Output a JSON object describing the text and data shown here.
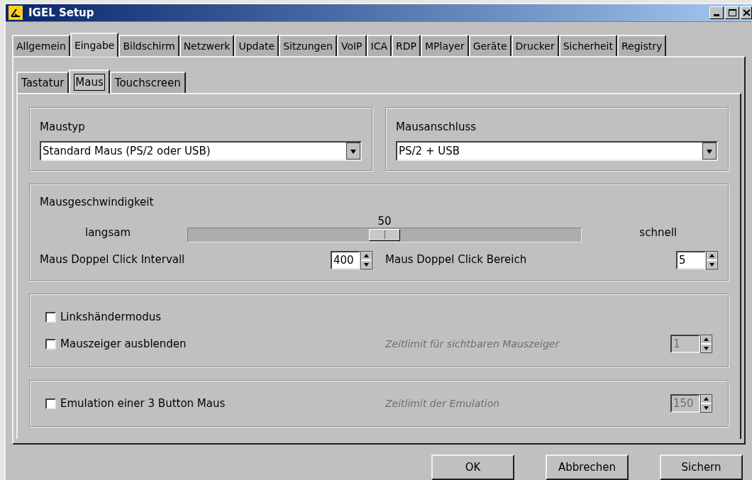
{
  "window": {
    "title": "IGEL Setup"
  },
  "tabs": [
    {
      "label": "Allgemein",
      "selected": false
    },
    {
      "label": "Eingabe",
      "selected": true
    },
    {
      "label": "Bildschirm",
      "selected": false
    },
    {
      "label": "Netzwerk",
      "selected": false
    },
    {
      "label": "Update",
      "selected": false
    },
    {
      "label": "Sitzungen",
      "selected": false
    },
    {
      "label": "VoIP",
      "selected": false
    },
    {
      "label": "ICA",
      "selected": false
    },
    {
      "label": "RDP",
      "selected": false
    },
    {
      "label": "MPlayer",
      "selected": false
    },
    {
      "label": "Geräte",
      "selected": false
    },
    {
      "label": "Drucker",
      "selected": false
    },
    {
      "label": "Sicherheit",
      "selected": false
    },
    {
      "label": "Registry",
      "selected": false
    }
  ],
  "subtabs": [
    {
      "label": "Tastatur",
      "selected": false
    },
    {
      "label": "Maus",
      "selected": true
    },
    {
      "label": "Touchscreen",
      "selected": false
    }
  ],
  "dropdowns": [
    {
      "label": "Maustyp",
      "value": "Standard Maus (PS/2 oder USB)"
    },
    {
      "label": "Mausanschluss",
      "value": "PS/2 + USB"
    }
  ],
  "speed": {
    "label": "Mausgeschwindigkeit",
    "min_label": "langsam",
    "max_label": "schnell",
    "reading": "50",
    "level": 0.5
  },
  "spinners": [
    {
      "label": "Maus Doppel Click Intervall",
      "value": "400",
      "disabled": false
    },
    {
      "label": "Maus Doppel Click Bereich",
      "value": "5",
      "disabled": false
    }
  ],
  "option_groups": [
    {
      "options": [
        {
          "label": "Linkshändermodus",
          "checked": false
        },
        {
          "label": "Mauszeiger ausblenden",
          "checked": false,
          "timeout": {
            "label": "Zeitlimit für sichtbaren Mauszeiger",
            "value": "1",
            "disabled": true
          }
        }
      ]
    },
    {
      "options": [
        {
          "label": "Emulation einer 3 Button Maus",
          "checked": false,
          "timeout": {
            "label": "Zeitlimit der Emulation",
            "value": "150",
            "disabled": true
          }
        }
      ]
    }
  ],
  "buttons": [
    "OK",
    "Abbrechen",
    "Sichern"
  ]
}
